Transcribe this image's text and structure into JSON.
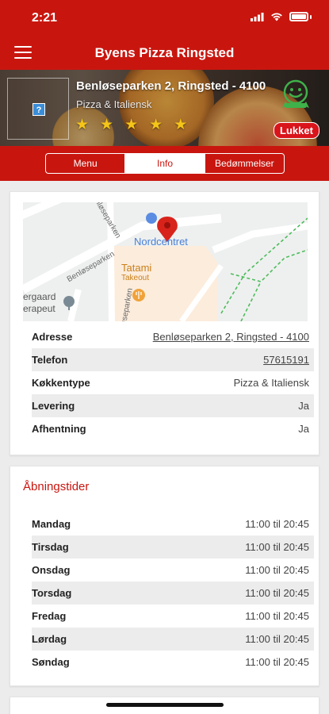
{
  "status_bar": {
    "time": "2:21"
  },
  "header": {
    "title": "Byens Pizza Ringsted"
  },
  "restaurant": {
    "address": "Benløseparken 2, Ringsted - 4100",
    "cuisine": "Pizza & Italiensk",
    "rating": 5,
    "status_badge": "Lukket"
  },
  "tabs": [
    {
      "label": "Menu",
      "active": false
    },
    {
      "label": "Info",
      "active": true
    },
    {
      "label": "Bedømmelser",
      "active": false
    }
  ],
  "map": {
    "street_labels": [
      "Benløseparken",
      "Benløseparken",
      "Benløseparken"
    ],
    "poi_center": "Nordcentret",
    "poi_restaurant": "Tatami",
    "poi_restaurant_sub": "Takeout",
    "poi_left_1": "ergaard",
    "poi_left_2": "erapeut"
  },
  "info": {
    "rows": [
      {
        "label": "Adresse",
        "value": "Benløseparken 2, Ringsted - 4100",
        "link": true
      },
      {
        "label": "Telefon",
        "value": "57615191",
        "link": true
      },
      {
        "label": "Køkkentype",
        "value": "Pizza & Italiensk",
        "link": false
      },
      {
        "label": "Levering",
        "value": "Ja",
        "link": false
      },
      {
        "label": "Afhentning",
        "value": "Ja",
        "link": false
      }
    ]
  },
  "hours": {
    "title": "Åbningstider",
    "rows": [
      {
        "day": "Mandag",
        "time": "11:00 til 20:45"
      },
      {
        "day": "Tirsdag",
        "time": "11:00 til 20:45"
      },
      {
        "day": "Onsdag",
        "time": "11:00 til 20:45"
      },
      {
        "day": "Torsdag",
        "time": "11:00 til 20:45"
      },
      {
        "day": "Fredag",
        "time": "11:00 til 20:45"
      },
      {
        "day": "Lørdag",
        "time": "11:00 til 20:45"
      },
      {
        "day": "Søndag",
        "time": "11:00 til 20:45"
      }
    ]
  },
  "colors": {
    "brand": "#c8160f",
    "star": "#f5c518",
    "link_green": "#3fb14a"
  },
  "icons": {
    "menu": "hamburger-icon",
    "logo": "image-placeholder-icon",
    "smiley": "smiley-certificate-icon",
    "pin": "map-pin-icon"
  }
}
